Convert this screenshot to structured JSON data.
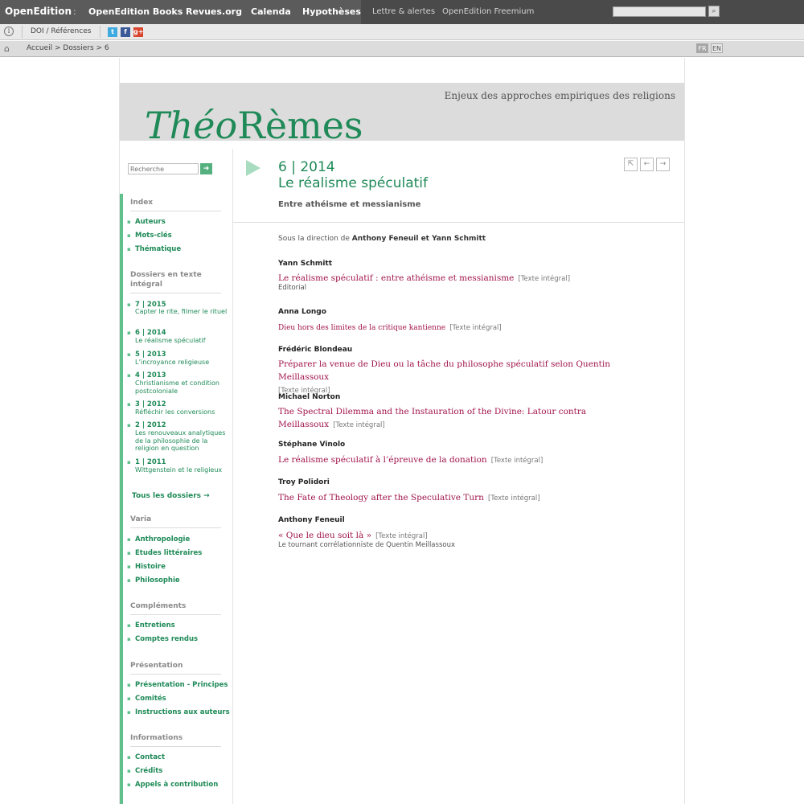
{
  "topbar": {
    "brand": "OpenEdition",
    "sep": ":",
    "portals": [
      "OpenEdition Books",
      "Revues.org",
      "Calenda",
      "Hypothèses"
    ],
    "links": [
      "Lettre & alertes",
      "OpenEdition Freemium"
    ],
    "search_icon": "magnifier-icon"
  },
  "bar2": {
    "doi": "DOI / Références",
    "social": [
      "t",
      "f",
      "g+"
    ]
  },
  "breadcrumb": {
    "path": "Accueil > Dossiers > 6",
    "langs": [
      "FR",
      "EN"
    ]
  },
  "banner": {
    "tagline": "Enjeux des approches empiriques des religions",
    "logo_italic": "Théo",
    "logo_rest": "Rèmes"
  },
  "sidebar": {
    "search_placeholder": "Recherche",
    "index_title": "Index",
    "index_items": [
      "Auteurs",
      "Mots-clés",
      "Thématique"
    ],
    "dossiers_title": "Dossiers en texte intégral",
    "issues": [
      {
        "num": "7 | 2015",
        "title": "Capter le rite, filmer le rituel"
      },
      {
        "num": "6 | 2014",
        "title": "Le réalisme spéculatif"
      },
      {
        "num": "5 | 2013",
        "title": "L’incroyance religieuse"
      },
      {
        "num": "4 | 2013",
        "title": "Christianisme et condition postcoloniale"
      },
      {
        "num": "3 | 2012",
        "title": "Réfléchir les conversions"
      },
      {
        "num": "2 | 2012",
        "title": "Les renouveaux analytiques de la philosophie de la religion en question"
      },
      {
        "num": "1 | 2011",
        "title": "Wittgenstein et le religieux"
      }
    ],
    "all_dossiers": "Tous les dossiers",
    "varia_title": "Varia",
    "varia_items": [
      "Anthropologie",
      "Etudes littéraires",
      "Histoire",
      "Philosophie"
    ],
    "complements_title": "Compléments",
    "complements_items": [
      "Entretiens",
      "Comptes rendus"
    ],
    "presentation_title": "Présentation",
    "presentation_items": [
      "Présentation - Principes",
      "Comités",
      "Instructions aux auteurs"
    ],
    "informations_title": "Informations",
    "informations_items": [
      "Contact",
      "Crédits",
      "Appels à contribution"
    ]
  },
  "main": {
    "issue_number": "6 | 2014",
    "issue_title": "Le réalisme spéculatif",
    "issue_subtitle": "Entre athéisme et messianisme",
    "direction_prefix": "Sous la direction de",
    "direction_names": "Anthony Feneuil et Yann Schmitt",
    "full_text_label": "[Texte intégral]",
    "articles": [
      {
        "author": "Yann Schmitt",
        "title": "Le réalisme spéculatif : entre athéisme et messianisme",
        "note": "Editorial"
      },
      {
        "author": "Anna Longo",
        "title": "Dieu hors des limites de la critique kantienne",
        "note": ""
      },
      {
        "author": "Frédéric Blondeau",
        "title": "Préparer la venue de Dieu ou la tâche du philosophe spéculatif selon Quentin Meillassoux",
        "note": ""
      },
      {
        "author": "Michael Norton",
        "title": "The Spectral Dilemma and the Instauration of the Divine: Latour contra Meillassoux",
        "note": ""
      },
      {
        "author": "Stéphane Vinolo",
        "title": "Le réalisme spéculatif à l’épreuve de la donation",
        "note": ""
      },
      {
        "author": "Troy Polidori",
        "title": "The Fate of Theology after the Speculative Turn",
        "note": ""
      },
      {
        "author": "Anthony Feneuil",
        "title": "« Que le dieu soit là »",
        "note": "Le tournant corrélationniste de Quentin Meillassoux"
      }
    ]
  }
}
